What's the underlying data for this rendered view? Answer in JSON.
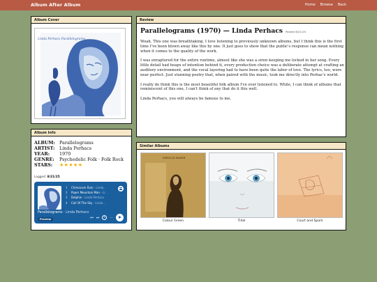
{
  "header": {
    "brand": "Album After Album",
    "nav": [
      "Home",
      "Browse",
      "Back"
    ]
  },
  "cover_panel": {
    "title": "Album Cover",
    "cover_text": "Linda Perhacs Parallelograms"
  },
  "info_panel": {
    "title": "Album Info",
    "rows": [
      {
        "key": "ALBUM:",
        "value": "Parallelograms"
      },
      {
        "key": "ARTIST:",
        "value": "Linda Perhacs"
      },
      {
        "key": "YEAR:",
        "value": "1970"
      },
      {
        "key": "GENRE:",
        "value": "Psychedelic Folk · Folk Rock"
      }
    ],
    "stars_label": "STARS:",
    "stars": "★★★★★",
    "rating": 5,
    "logged_label": "Logged:",
    "logged_date": "8/21/25"
  },
  "player": {
    "tracks": [
      {
        "n": "1",
        "title": "Chimacum Rain",
        "artist": "Linda..."
      },
      {
        "n": "2",
        "title": "Paper Mountain Man",
        "artist": "Li..."
      },
      {
        "n": "3",
        "title": "Dolphin",
        "artist": "Linda Perhacs"
      },
      {
        "n": "4",
        "title": "Call Of The Sky",
        "artist": "Linda..."
      }
    ],
    "now_title": "Parallelograms",
    "now_sep": " · ",
    "now_artist": "Linda Perhacs",
    "preview_label": "Preview"
  },
  "review": {
    "panel_title": "Review",
    "title": "Parallelograms (1970) — Linda Perhacs",
    "posted": "Posted 8/21/25",
    "paragraphs": [
      "Woah. This one was breathtaking. I love listening to previously unknown albums, but I think this is the first time I've been blown away like this by one. It just goes to show that the public's response can mean nothing when it comes to the quality of the work.",
      "I was enraptured for the entire runtime, almost like she was a siren keeping me locked in her song. Every little detail had heaps of intention behind it, every production choice was a deliberate attempt at crafting an auditory environment, and the vocal layering had to have been quite the labor of love. The lyrics, too, were near perfect. Just stunning poetry that, when paired with the music, took me directly into Perhac's world.",
      "I really do think this is the most beautiful folk album I've ever listened to. While, I can think of albums that reminiscent of this one, I can't think of any that do it this well.",
      "Linda Perhacs, you will always be famous to me."
    ]
  },
  "similar": {
    "panel_title": "Similar Albums",
    "items": [
      {
        "caption": "Colour Green",
        "cover_text": "SIBYLLE BAIER"
      },
      {
        "caption": "Tidal",
        "cover_text": ""
      },
      {
        "caption": "Court and Spark",
        "cover_text": ""
      }
    ]
  },
  "colors": {
    "background": "#8b9e74",
    "header": "#b85a44",
    "panel_head": "#f6e8c6",
    "player": "#1a5f9e",
    "stars": "#f2b100"
  }
}
